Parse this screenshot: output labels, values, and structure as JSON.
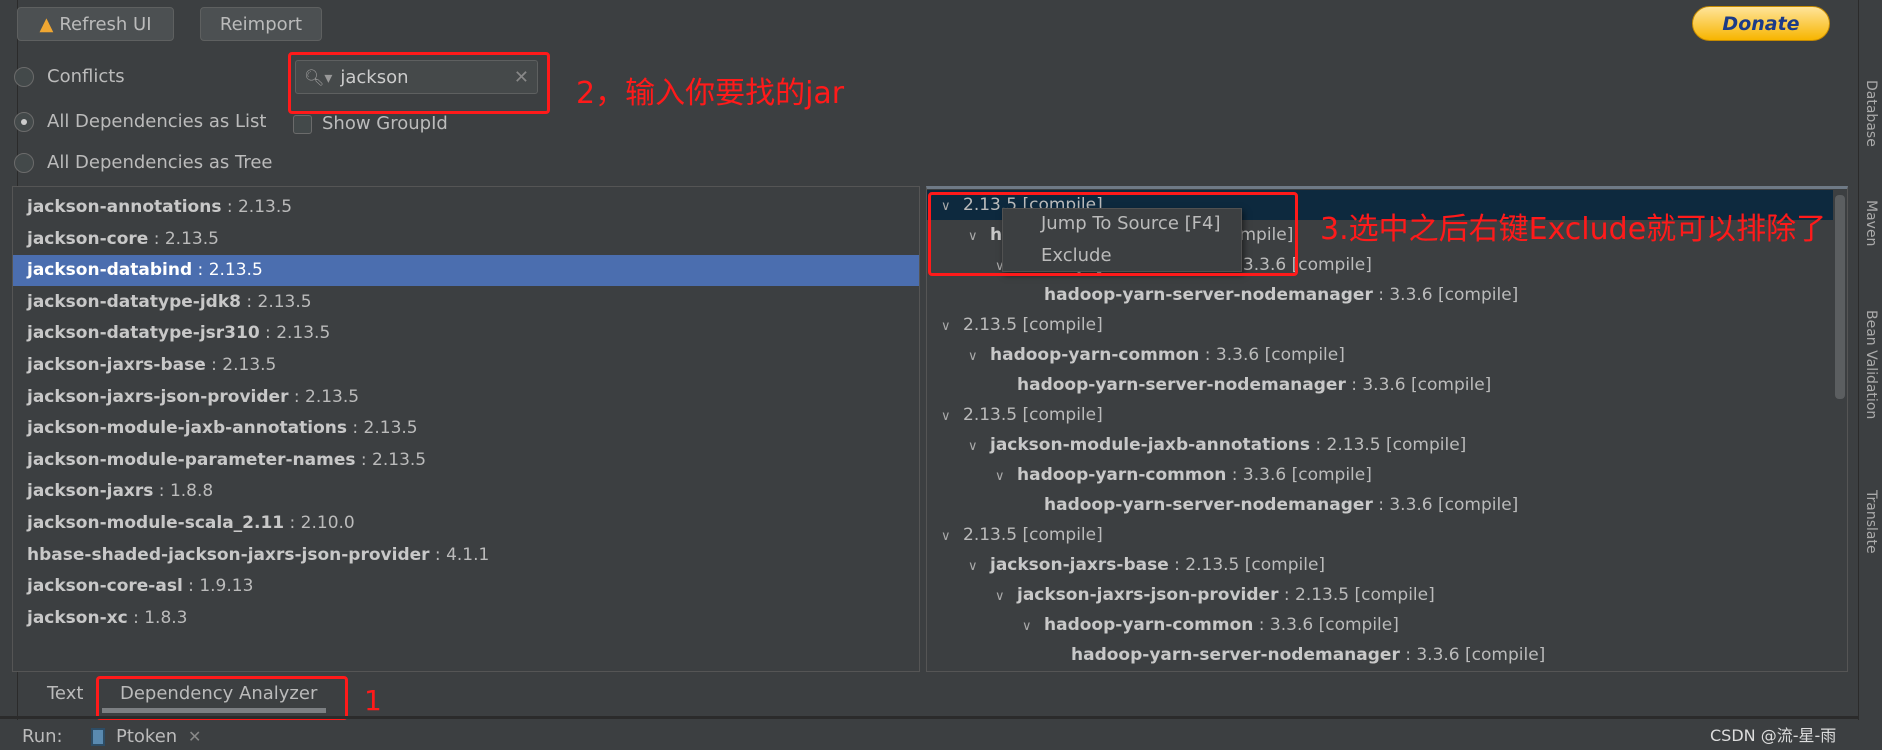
{
  "toolbar": {
    "refresh_label": "Refresh UI",
    "reimport_label": "Reimport",
    "donate_label": "Donate"
  },
  "modes": {
    "conflicts": "Conflicts",
    "list": "All Dependencies as List",
    "tree": "All Dependencies as Tree",
    "selected": "list"
  },
  "search": {
    "value": "jackson",
    "clear_icon": "close-icon"
  },
  "show_groupid": {
    "label": "Show GroupId",
    "checked": false
  },
  "annotations": {
    "step1": "1",
    "step2": "2，输入你要找的jar",
    "step3": "3.选中之后右键Exclude就可以排除了"
  },
  "list": [
    {
      "name": "jackson-annotations",
      "version": " : 2.13.5"
    },
    {
      "name": "jackson-core",
      "version": " : 2.13.5"
    },
    {
      "name": "jackson-databind",
      "version": " : 2.13.5",
      "selected": true
    },
    {
      "name": "jackson-datatype-jdk8",
      "version": " : 2.13.5"
    },
    {
      "name": "jackson-datatype-jsr310",
      "version": " : 2.13.5"
    },
    {
      "name": "jackson-jaxrs-base",
      "version": " : 2.13.5"
    },
    {
      "name": "jackson-jaxrs-json-provider",
      "version": " : 2.13.5"
    },
    {
      "name": "jackson-module-jaxb-annotations",
      "version": " : 2.13.5"
    },
    {
      "name": "jackson-module-parameter-names",
      "version": " : 2.13.5"
    },
    {
      "name": "jackson-jaxrs",
      "version": " : 1.8.8"
    },
    {
      "name": "jackson-module-scala_2.11",
      "version": " : 2.10.0"
    },
    {
      "name": "hbase-shaded-jackson-jaxrs-json-provider",
      "version": " : 4.1.1"
    },
    {
      "name": "jackson-core-asl",
      "version": " : 1.9.13"
    },
    {
      "name": "jackson-xc",
      "version": " : 1.8.3"
    }
  ],
  "tree": [
    {
      "level": 0,
      "name": "",
      "version": "2.13.5 [compile]",
      "expanded": true,
      "selected": true
    },
    {
      "level": 1,
      "name": "hadoop-yarn-api",
      "version": " : 3.3.6 [compile]",
      "expanded": true
    },
    {
      "level": 2,
      "name": "hadoop-yarn-common",
      "version": " : 3.3.6 [compile]",
      "expanded": true
    },
    {
      "level": 3,
      "name": "hadoop-yarn-server-nodemanager",
      "version": " : 3.3.6 [compile]"
    },
    {
      "level": 0,
      "name": "",
      "version": "2.13.5 [compile]",
      "expanded": true
    },
    {
      "level": 1,
      "name": "hadoop-yarn-common",
      "version": " : 3.3.6 [compile]",
      "expanded": true
    },
    {
      "level": 2,
      "name": "hadoop-yarn-server-nodemanager",
      "version": " : 3.3.6 [compile]"
    },
    {
      "level": 0,
      "name": "",
      "version": "2.13.5 [compile]",
      "expanded": true
    },
    {
      "level": 1,
      "name": "jackson-module-jaxb-annotations",
      "version": " : 2.13.5 [compile]",
      "expanded": true
    },
    {
      "level": 2,
      "name": "hadoop-yarn-common",
      "version": " : 3.3.6 [compile]",
      "expanded": true
    },
    {
      "level": 3,
      "name": "hadoop-yarn-server-nodemanager",
      "version": " : 3.3.6 [compile]"
    },
    {
      "level": 0,
      "name": "",
      "version": "2.13.5 [compile]",
      "expanded": true
    },
    {
      "level": 1,
      "name": "jackson-jaxrs-base",
      "version": " : 2.13.5 [compile]",
      "expanded": true
    },
    {
      "level": 2,
      "name": "jackson-jaxrs-json-provider",
      "version": " : 2.13.5 [compile]",
      "expanded": true
    },
    {
      "level": 3,
      "name": "hadoop-yarn-common",
      "version": " : 3.3.6 [compile]",
      "expanded": true
    },
    {
      "level": 4,
      "name": "hadoop-yarn-server-nodemanager",
      "version": " : 3.3.6 [compile]"
    }
  ],
  "context_menu": {
    "items": [
      "Jump To Source [F4]",
      "Exclude"
    ]
  },
  "bottom_tabs": {
    "text": "Text",
    "analyzer": "Dependency Analyzer",
    "active": "analyzer"
  },
  "run_bar": {
    "label": "Run:",
    "tab": "Ptoken"
  },
  "right_sidebar": [
    "Database",
    "Maven",
    "Bean Validation",
    "Translate"
  ],
  "watermark": "CSDN @流-星-雨",
  "colors": {
    "selection": "#4b6eaf",
    "tree_selection": "#0d293e",
    "annotation": "#ff1a1a",
    "donate": "#f7b500"
  }
}
